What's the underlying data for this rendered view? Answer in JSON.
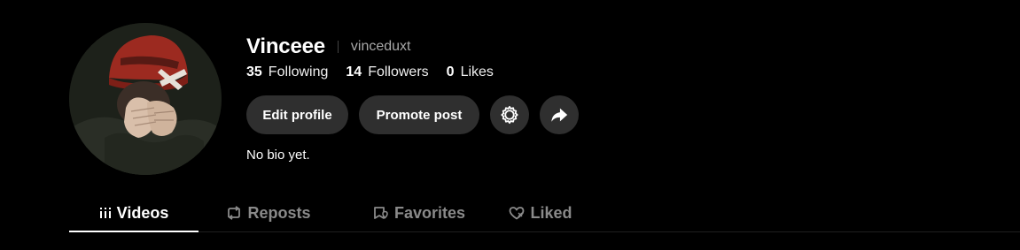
{
  "profile": {
    "display_name": "Vinceee",
    "username": "vinceduxt",
    "bio": "No bio yet.",
    "avatar_icon": "profile-photo"
  },
  "stats": [
    {
      "count": "35",
      "label": "Following"
    },
    {
      "count": "14",
      "label": "Followers"
    },
    {
      "count": "0",
      "label": "Likes"
    }
  ],
  "actions": {
    "edit_profile": "Edit profile",
    "promote_post": "Promote post",
    "settings_icon": "gear-icon",
    "share_icon": "share-arrow-icon"
  },
  "tabs": [
    {
      "label": "Videos",
      "icon": "grid-bars-icon",
      "active": true
    },
    {
      "label": "Reposts",
      "icon": "repost-icon",
      "active": false
    },
    {
      "label": "Favorites",
      "icon": "bookmark-icon",
      "active": false
    },
    {
      "label": "Liked",
      "icon": "heart-icon",
      "active": false
    }
  ],
  "colors": {
    "background": "#000000",
    "button_bg": "#2f2f2f",
    "text_primary": "#ffffff",
    "text_secondary": "#a8a8a8",
    "tab_inactive": "#8a8a8a"
  }
}
